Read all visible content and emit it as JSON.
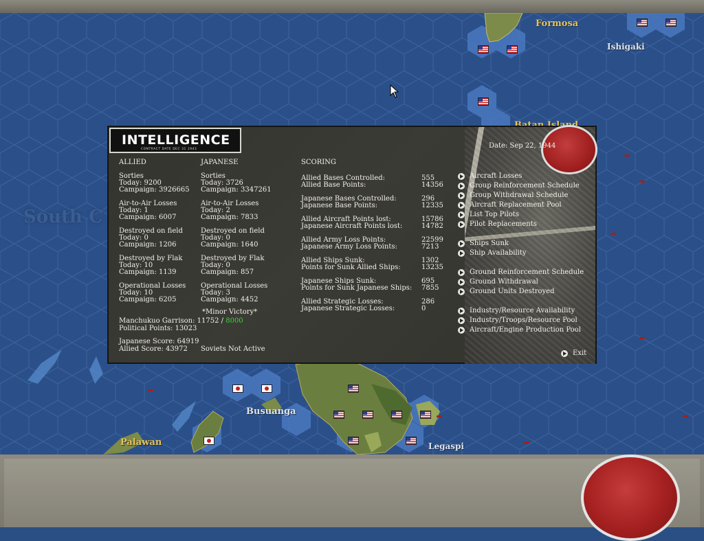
{
  "map": {
    "labels": {
      "formosa": "Formosa",
      "ishigaki": "Ishigaki",
      "batan": "Batan Island",
      "busuanga": "Busuanga",
      "palawan": "Palawan",
      "legaspi": "Legaspi",
      "south_china": "South C"
    }
  },
  "panel": {
    "title": "INTELLIGENCE",
    "subtitle": "CONTRACT DATE DEC 31 1943",
    "date": "Date: Sep 22, 1944",
    "allied": {
      "header": "ALLIED",
      "sorties": {
        "label": "Sorties",
        "today": "Today:      9200",
        "campaign": "Campaign: 3926665"
      },
      "a2a": {
        "label": "Air-to-Air Losses",
        "today": "Today:       1",
        "campaign": "Campaign: 6007"
      },
      "field": {
        "label": "Destroyed on field",
        "today": "Today:       0",
        "campaign": "Campaign: 1206"
      },
      "flak": {
        "label": "Destroyed by Flak",
        "today": "Today:      10",
        "campaign": "Campaign: 1139"
      },
      "ops": {
        "label": "Operational Losses",
        "today": "Today:      10",
        "campaign": "Campaign: 6205"
      },
      "manchukuo_label": "Manchukuo Garrison: 11752 / ",
      "manchukuo_value": "8000",
      "political": "Political Points: 13023",
      "japanese_score": "Japanese Score: 64919",
      "allied_score": "Allied Score: 43972"
    },
    "japanese": {
      "header": "JAPANESE",
      "sorties": {
        "label": "Sorties",
        "today": "Today:      3726",
        "campaign": "Campaign: 3347261"
      },
      "a2a": {
        "label": "Air-to-Air Losses",
        "today": "Today:       2",
        "campaign": "Campaign: 7833"
      },
      "field": {
        "label": "Destroyed on field",
        "today": "Today:       0",
        "campaign": "Campaign: 1640"
      },
      "flak": {
        "label": "Destroyed by Flak",
        "today": "Today:       0",
        "campaign": "Campaign: 857"
      },
      "ops": {
        "label": "Operational Losses",
        "today": "Today:       3",
        "campaign": "Campaign: 4452"
      },
      "victory": "*Minor Victory*",
      "soviets": "Soviets Not Active"
    },
    "scoring": {
      "header": "SCORING",
      "rows": [
        {
          "label": "Allied Bases Controlled:",
          "value": "555"
        },
        {
          "label": "Allied Base Points:",
          "value": "14356"
        },
        {
          "label": "Japanese Bases Controlled:",
          "value": "296"
        },
        {
          "label": "Japanese Base Points:",
          "value": "12335"
        },
        {
          "label": "Allied Aircraft Points lost:",
          "value": "15786"
        },
        {
          "label": "Japanese Aircraft Points lost:",
          "value": "14782"
        },
        {
          "label": "Allied Army Loss Points:",
          "value": "22599"
        },
        {
          "label": "Japanese Army Loss Points:",
          "value": "7213"
        },
        {
          "label": "Allied Ships Sunk:",
          "value": "1302"
        },
        {
          "label": "Points for Sunk Allied Ships:",
          "value": "13235"
        },
        {
          "label": "Japanese Ships Sunk:",
          "value": "695"
        },
        {
          "label": "Points for Sunk Japanese Ships:",
          "value": "7855"
        },
        {
          "label": "Allied Strategic Losses:",
          "value": "286"
        },
        {
          "label": "Japanese Strategic Losses:",
          "value": "0"
        }
      ]
    },
    "links": [
      "Aircraft Losses",
      "Group Reinforcement Schedule",
      "Group Withdrawal Schedule",
      "Aircraft Replacement Pool",
      "List Top Pilots",
      "Pilot Replacements",
      "Ships Sunk",
      "Ship Availability",
      "Ground Reinforcement Schedule",
      "Ground Withdrawal",
      "Ground Units Destroyed",
      "Industry/Resource Availability",
      "Industry/Troops/Resource Pool",
      "Aircraft/Engine Production Pool"
    ],
    "exit": "Exit"
  }
}
